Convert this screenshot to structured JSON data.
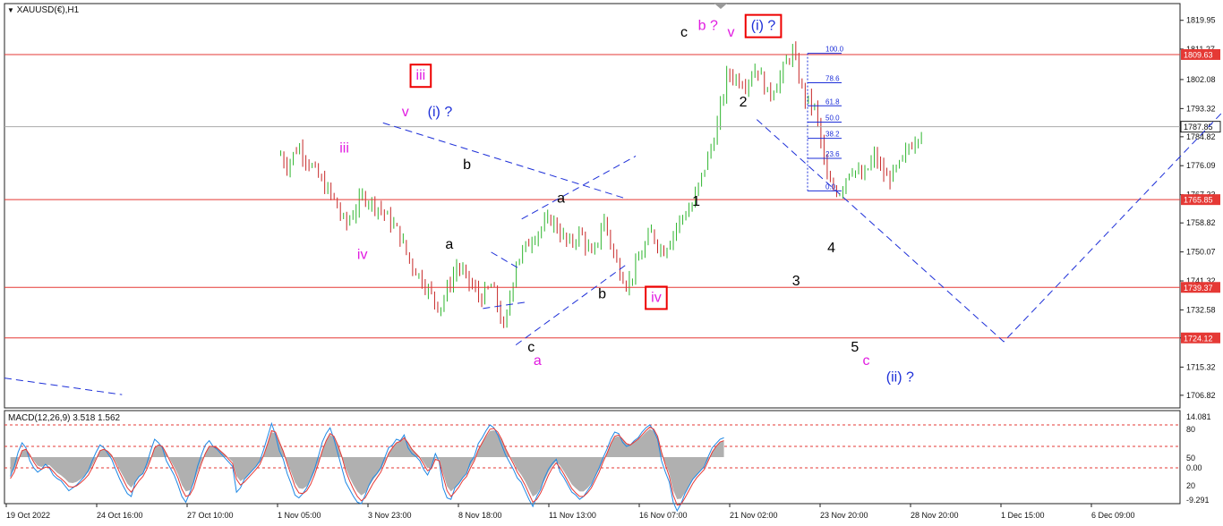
{
  "window": {
    "symbol_label": "XAUUSD(€),H1"
  },
  "indicator": {
    "label": "MACD(12,26,9) 3.518 1.562"
  },
  "colors": {
    "bull": "#2fb52f",
    "bear": "#c62828",
    "level": "#e53935",
    "wave": "#1d2fd8",
    "magenta": "#e11ce1",
    "macd": "#1e88e5",
    "signal": "#e53935",
    "hist": "#b0b0b0"
  },
  "chart_data": [
    {
      "type": "candlestick",
      "title": "XAUUSD(€),H1",
      "ylim": [
        1703,
        1825
      ],
      "y_ticks": [
        "1819.95",
        "1811.27",
        "1802.08",
        "1793.32",
        "1784.82",
        "1776.09",
        "1767.33",
        "1758.82",
        "1750.07",
        "1741.32",
        "1732.58",
        "1724.12",
        "1715.32",
        "1706.82"
      ],
      "x_ticks": [
        "19 Oct 2022",
        "24 Oct 16:00",
        "27 Oct 10:00",
        "1 Nov 05:00",
        "3 Nov 23:00",
        "8 Nov 18:00",
        "11 Nov 13:00",
        "16 Nov 07:00",
        "21 Nov 02:00",
        "23 Nov 20:00",
        "28 Nov 20:00",
        "1 Dec 15:00",
        "6 Dec 09:00"
      ],
      "price_path": [
        {
          "t": 0,
          "p": 1709
        },
        {
          "t": 0.02,
          "p": 1712
        },
        {
          "t": 0.05,
          "p": 1709
        },
        {
          "t": 0.07,
          "p": 1712
        },
        {
          "t": 0.08,
          "p": 1707
        },
        {
          "t": 0.095,
          "p": 1727
        },
        {
          "t": 0.11,
          "p": 1758
        },
        {
          "t": 0.125,
          "p": 1763
        },
        {
          "t": 0.14,
          "p": 1765
        },
        {
          "t": 0.155,
          "p": 1755
        },
        {
          "t": 0.17,
          "p": 1770
        },
        {
          "t": 0.19,
          "p": 1781
        },
        {
          "t": 0.2,
          "p": 1772
        },
        {
          "t": 0.215,
          "p": 1783
        },
        {
          "t": 0.225,
          "p": 1786
        },
        {
          "t": 0.24,
          "p": 1776
        },
        {
          "t": 0.25,
          "p": 1782
        },
        {
          "t": 0.27,
          "p": 1771
        },
        {
          "t": 0.28,
          "p": 1766
        },
        {
          "t": 0.29,
          "p": 1758
        },
        {
          "t": 0.305,
          "p": 1767
        },
        {
          "t": 0.32,
          "p": 1763
        },
        {
          "t": 0.335,
          "p": 1756
        },
        {
          "t": 0.345,
          "p": 1747
        },
        {
          "t": 0.36,
          "p": 1739
        },
        {
          "t": 0.37,
          "p": 1733
        },
        {
          "t": 0.385,
          "p": 1746
        },
        {
          "t": 0.395,
          "p": 1741
        },
        {
          "t": 0.405,
          "p": 1736
        },
        {
          "t": 0.415,
          "p": 1740
        },
        {
          "t": 0.425,
          "p": 1726
        },
        {
          "t": 0.435,
          "p": 1747
        },
        {
          "t": 0.45,
          "p": 1755
        },
        {
          "t": 0.465,
          "p": 1760
        },
        {
          "t": 0.48,
          "p": 1752
        },
        {
          "t": 0.49,
          "p": 1756
        },
        {
          "t": 0.5,
          "p": 1748
        },
        {
          "t": 0.51,
          "p": 1760
        },
        {
          "t": 0.52,
          "p": 1747
        },
        {
          "t": 0.53,
          "p": 1740
        },
        {
          "t": 0.54,
          "p": 1748
        },
        {
          "t": 0.55,
          "p": 1756
        },
        {
          "t": 0.56,
          "p": 1750
        },
        {
          "t": 0.575,
          "p": 1760
        },
        {
          "t": 0.585,
          "p": 1764
        },
        {
          "t": 0.595,
          "p": 1775
        },
        {
          "t": 0.605,
          "p": 1786
        },
        {
          "t": 0.615,
          "p": 1804
        },
        {
          "t": 0.63,
          "p": 1801
        },
        {
          "t": 0.64,
          "p": 1806
        },
        {
          "t": 0.65,
          "p": 1797
        },
        {
          "t": 0.66,
          "p": 1803
        },
        {
          "t": 0.67,
          "p": 1811
        },
        {
          "t": 0.68,
          "p": 1797
        },
        {
          "t": 0.69,
          "p": 1793
        },
        {
          "t": 0.7,
          "p": 1771
        },
        {
          "t": 0.71,
          "p": 1768
        },
        {
          "t": 0.72,
          "p": 1776
        },
        {
          "t": 0.73,
          "p": 1772
        },
        {
          "t": 0.74,
          "p": 1779
        },
        {
          "t": 0.75,
          "p": 1772
        },
        {
          "t": 0.76,
          "p": 1775
        },
        {
          "t": 0.77,
          "p": 1782
        },
        {
          "t": 0.78,
          "p": 1787
        }
      ],
      "levels": [
        {
          "value": 1809.63,
          "label": "1809.63"
        },
        {
          "value": 1765.85,
          "label": "1765.85"
        },
        {
          "value": 1739.37,
          "label": "1739.37"
        },
        {
          "value": 1724.12,
          "label": "1724.12"
        }
      ],
      "current_price": {
        "value": 1787.85,
        "label": "1787.85"
      },
      "fibonacci": {
        "from": 1768.5,
        "to": 1810.0,
        "labels": [
          "100.0",
          "78.6",
          "61.8",
          "50.0",
          "38.2",
          "23.6",
          "0.0"
        ],
        "ratios": [
          1.0,
          0.786,
          0.618,
          0.5,
          0.382,
          0.236,
          0.0
        ]
      },
      "projection": [
        {
          "t": 0.64,
          "p": 1790
        },
        {
          "t": 0.85,
          "p": 1723
        },
        {
          "t": 1.1,
          "p": 1816
        }
      ],
      "wave_labels": [
        {
          "text": "iii",
          "color": "magenta",
          "boxed": true,
          "t": 0.35,
          "p": 1802
        },
        {
          "text": "v",
          "color": "magenta",
          "t": 0.338,
          "p": 1791
        },
        {
          "text": "(i) ?",
          "color": "wave",
          "t": 0.36,
          "p": 1791
        },
        {
          "text": "iii",
          "color": "magenta",
          "t": 0.285,
          "p": 1780
        },
        {
          "text": "iv",
          "color": "magenta",
          "t": 0.3,
          "p": 1748
        },
        {
          "text": "b",
          "color": "black",
          "t": 0.39,
          "p": 1775
        },
        {
          "text": "a",
          "color": "black",
          "t": 0.375,
          "p": 1751
        },
        {
          "text": "a",
          "color": "black",
          "t": 0.47,
          "p": 1765
        },
        {
          "text": "b",
          "color": "black",
          "t": 0.505,
          "p": 1736
        },
        {
          "text": "c",
          "color": "black",
          "t": 0.445,
          "p": 1720
        },
        {
          "text": "a",
          "color": "magenta",
          "t": 0.45,
          "p": 1716
        },
        {
          "text": "iv",
          "color": "magenta",
          "boxed": true,
          "t": 0.55,
          "p": 1735
        },
        {
          "text": "c",
          "color": "black",
          "t": 0.575,
          "p": 1815
        },
        {
          "text": "b ?",
          "color": "magenta",
          "t": 0.59,
          "p": 1817
        },
        {
          "text": "v",
          "color": "magenta",
          "t": 0.615,
          "p": 1815
        },
        {
          "text": "(i) ?",
          "color": "wave",
          "boxed": true,
          "t": 0.635,
          "p": 1817
        },
        {
          "text": "2",
          "color": "black",
          "t": 0.625,
          "p": 1794
        },
        {
          "text": "1",
          "color": "black",
          "t": 0.585,
          "p": 1764
        },
        {
          "text": "4",
          "color": "black",
          "t": 0.7,
          "p": 1750
        },
        {
          "text": "3",
          "color": "black",
          "t": 0.67,
          "p": 1740
        },
        {
          "text": "5",
          "color": "black",
          "t": 0.72,
          "p": 1720
        },
        {
          "text": "c",
          "color": "magenta",
          "t": 0.73,
          "p": 1716
        },
        {
          "text": "(ii) ?",
          "color": "wave",
          "t": 0.75,
          "p": 1711
        }
      ]
    },
    {
      "type": "line",
      "title": "MACD(12,26,9) 3.518 1.562",
      "ylim": [
        -30,
        100
      ],
      "y_ticks": [
        "14.081",
        "80",
        "50",
        "0.00",
        "20",
        "-9.291"
      ],
      "dashed_levels": [
        80,
        50,
        20
      ],
      "series": [
        {
          "values": [
            8,
            22,
            42,
            55,
            48,
            30,
            20,
            14,
            18,
            25,
            20,
            10,
            5,
            2,
            -5,
            -12,
            -8,
            -4,
            2,
            8,
            16,
            30,
            42,
            52,
            48,
            40,
            32,
            18,
            5,
            -6,
            -16,
            -20,
            0,
            8,
            12,
            26,
            44,
            60,
            55,
            48,
            30,
            20,
            10,
            -4,
            -20,
            -28,
            -15,
            0,
            22,
            38,
            52,
            58,
            50,
            46,
            40,
            34,
            28,
            22,
            -14,
            -8,
            4,
            10,
            16,
            22,
            30,
            46,
            64,
            82,
            66,
            44,
            32,
            12,
            -2,
            -18,
            -22,
            -16,
            -8,
            4,
            18,
            36,
            56,
            68,
            76,
            60,
            40,
            20,
            0,
            -10,
            -20,
            -28,
            -30,
            -18,
            -4,
            6,
            12,
            20,
            34,
            48,
            52,
            60,
            58,
            66,
            48,
            40,
            36,
            30,
            18,
            10,
            22,
            40,
            28,
            -8,
            -22,
            -24,
            -8,
            -2,
            6,
            12,
            28,
            36,
            54,
            62,
            72,
            80,
            76,
            66,
            52,
            38,
            28,
            18,
            6,
            0,
            -12,
            -24,
            -34,
            -20,
            -10,
            6,
            18,
            26,
            32,
            14,
            6,
            -4,
            -14,
            -18,
            -24,
            -20,
            -12,
            -4,
            8,
            20,
            34,
            46,
            60,
            70,
            68,
            56,
            50,
            52,
            58,
            62,
            70,
            76,
            80,
            72,
            60,
            30,
            14,
            0,
            -28,
            -40,
            -30,
            -16,
            -6,
            4,
            10,
            16,
            22,
            36,
            48,
            54,
            60,
            62
          ]
        },
        {
          "values": [
            5,
            14,
            30,
            44,
            46,
            38,
            28,
            20,
            18,
            21,
            21,
            15,
            9,
            5,
            0,
            -6,
            -7,
            -5,
            -1,
            4,
            10,
            20,
            32,
            44,
            46,
            43,
            37,
            26,
            14,
            3,
            -8,
            -14,
            -6,
            2,
            8,
            18,
            32,
            48,
            52,
            50,
            40,
            29,
            18,
            6,
            -10,
            -20,
            -18,
            -8,
            10,
            26,
            40,
            50,
            50,
            48,
            43,
            38,
            32,
            26,
            4,
            -4,
            0,
            6,
            12,
            18,
            25,
            38,
            54,
            72,
            70,
            56,
            43,
            26,
            10,
            -6,
            -15,
            -16,
            -12,
            -3,
            10,
            26,
            44,
            58,
            68,
            64,
            52,
            36,
            16,
            2,
            -10,
            -20,
            -26,
            -22,
            -12,
            -2,
            6,
            14,
            26,
            40,
            48,
            55,
            57,
            62,
            55,
            46,
            40,
            34,
            25,
            16,
            19,
            32,
            30,
            8,
            -12,
            -20,
            -14,
            -7,
            2,
            8,
            20,
            30,
            45,
            55,
            65,
            74,
            75,
            70,
            60,
            47,
            36,
            26,
            14,
            6,
            -4,
            -16,
            -28,
            -24,
            -15,
            -3,
            10,
            20,
            27,
            20,
            11,
            1,
            -9,
            -15,
            -20,
            -20,
            -15,
            -8,
            3,
            14,
            28,
            40,
            54,
            64,
            66,
            60,
            54,
            52,
            56,
            60,
            66,
            72,
            77,
            74,
            64,
            42,
            24,
            8,
            -18,
            -32,
            -31,
            -22,
            -12,
            -2,
            6,
            12,
            18,
            30,
            42,
            50,
            56,
            58
          ]
        }
      ]
    }
  ]
}
